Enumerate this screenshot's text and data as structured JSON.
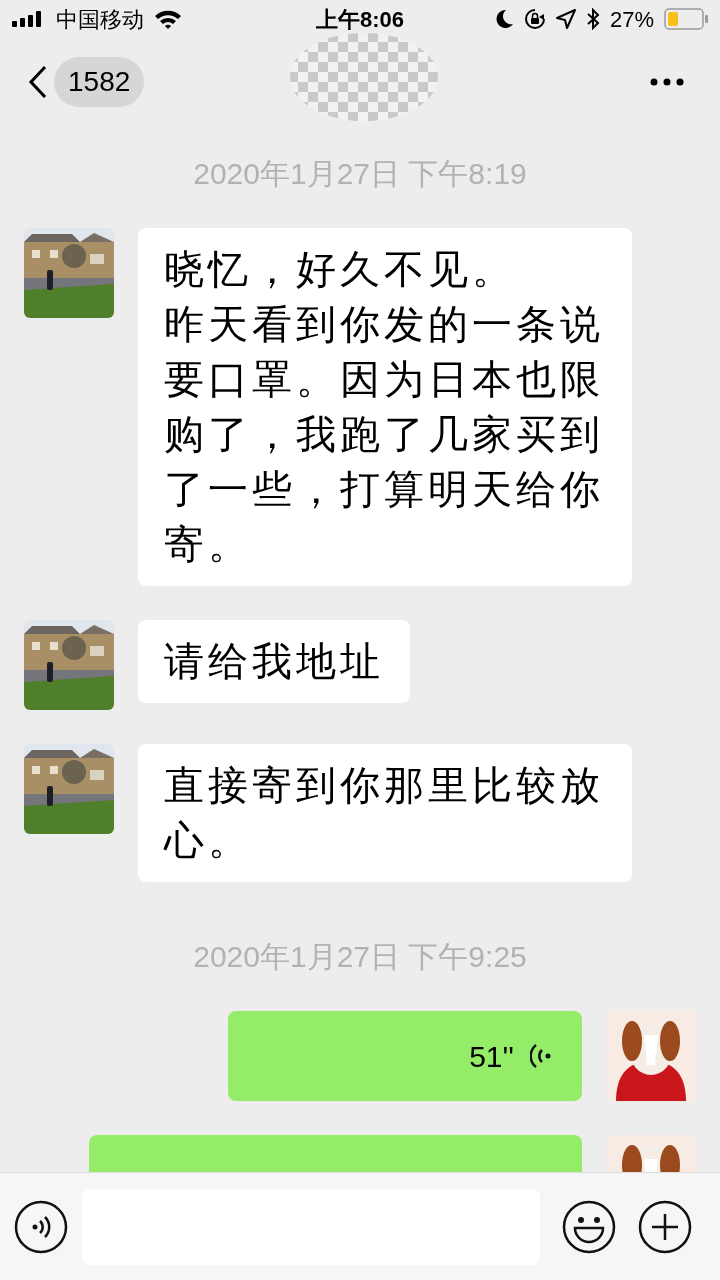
{
  "status_bar": {
    "carrier": "中国移动",
    "time": "上午8:06",
    "battery": "27%"
  },
  "nav": {
    "back_count": "1582"
  },
  "messages": [
    {
      "kind": "timestamp",
      "text": "2020年1月27日 下午8:19"
    },
    {
      "kind": "text",
      "outgoing": false,
      "paragraphs": [
        "晓忆，好久不见。",
        "昨天看到你发的一条说要口罩。因为日本也限购了，我跑了几家买到了一些，打算明天给你寄。"
      ]
    },
    {
      "kind": "text",
      "outgoing": false,
      "paragraphs": [
        "请给我地址"
      ]
    },
    {
      "kind": "text",
      "outgoing": false,
      "paragraphs": [
        "直接寄到你那里比较放心。"
      ]
    },
    {
      "kind": "timestamp",
      "text": "2020年1月27日 下午9:25"
    },
    {
      "kind": "voice",
      "outgoing": true,
      "duration": "51''"
    },
    {
      "kind": "cut",
      "outgoing": true
    }
  ]
}
